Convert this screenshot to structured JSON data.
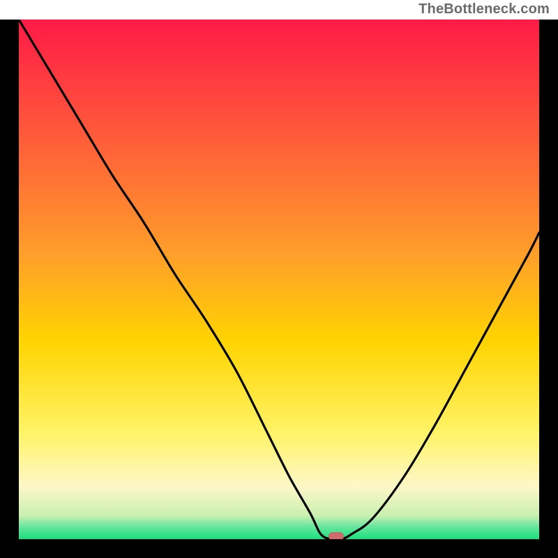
{
  "attribution": "TheBottleneck.com",
  "colors": {
    "frame": "#000000",
    "top": "#ff1a46",
    "mid": "#ffd400",
    "pale": "#fdf7c8",
    "green": "#18e07e",
    "curve": "#000000",
    "marker": "#cf6a6f"
  },
  "chart_data": {
    "type": "line",
    "title": "",
    "xlabel": "",
    "ylabel": "",
    "xlim": [
      0,
      100
    ],
    "ylim": [
      0,
      100
    ],
    "optimum_x": 60,
    "series": [
      {
        "name": "bottleneck-curve",
        "x": [
          0,
          6,
          12,
          18,
          24,
          30,
          36,
          42,
          48,
          52,
          56,
          58,
          60,
          62,
          64,
          68,
          74,
          80,
          86,
          92,
          98,
          100
        ],
        "y": [
          100,
          90,
          80,
          70,
          61,
          51,
          42,
          32,
          20,
          12,
          5,
          1,
          0,
          0,
          1,
          4,
          12,
          22,
          33,
          44,
          55,
          59
        ]
      }
    ],
    "marker": {
      "x": 61,
      "y": 0.5
    },
    "gradient_stops": [
      {
        "pos": 0.0,
        "color": "#ff1a46"
      },
      {
        "pos": 0.22,
        "color": "#ff5a3a"
      },
      {
        "pos": 0.45,
        "color": "#ff9e2a"
      },
      {
        "pos": 0.62,
        "color": "#ffd400"
      },
      {
        "pos": 0.8,
        "color": "#fff46a"
      },
      {
        "pos": 0.9,
        "color": "#fdf7c8"
      },
      {
        "pos": 0.955,
        "color": "#c9efb0"
      },
      {
        "pos": 0.975,
        "color": "#6ce6a0"
      },
      {
        "pos": 1.0,
        "color": "#18e07e"
      }
    ]
  }
}
